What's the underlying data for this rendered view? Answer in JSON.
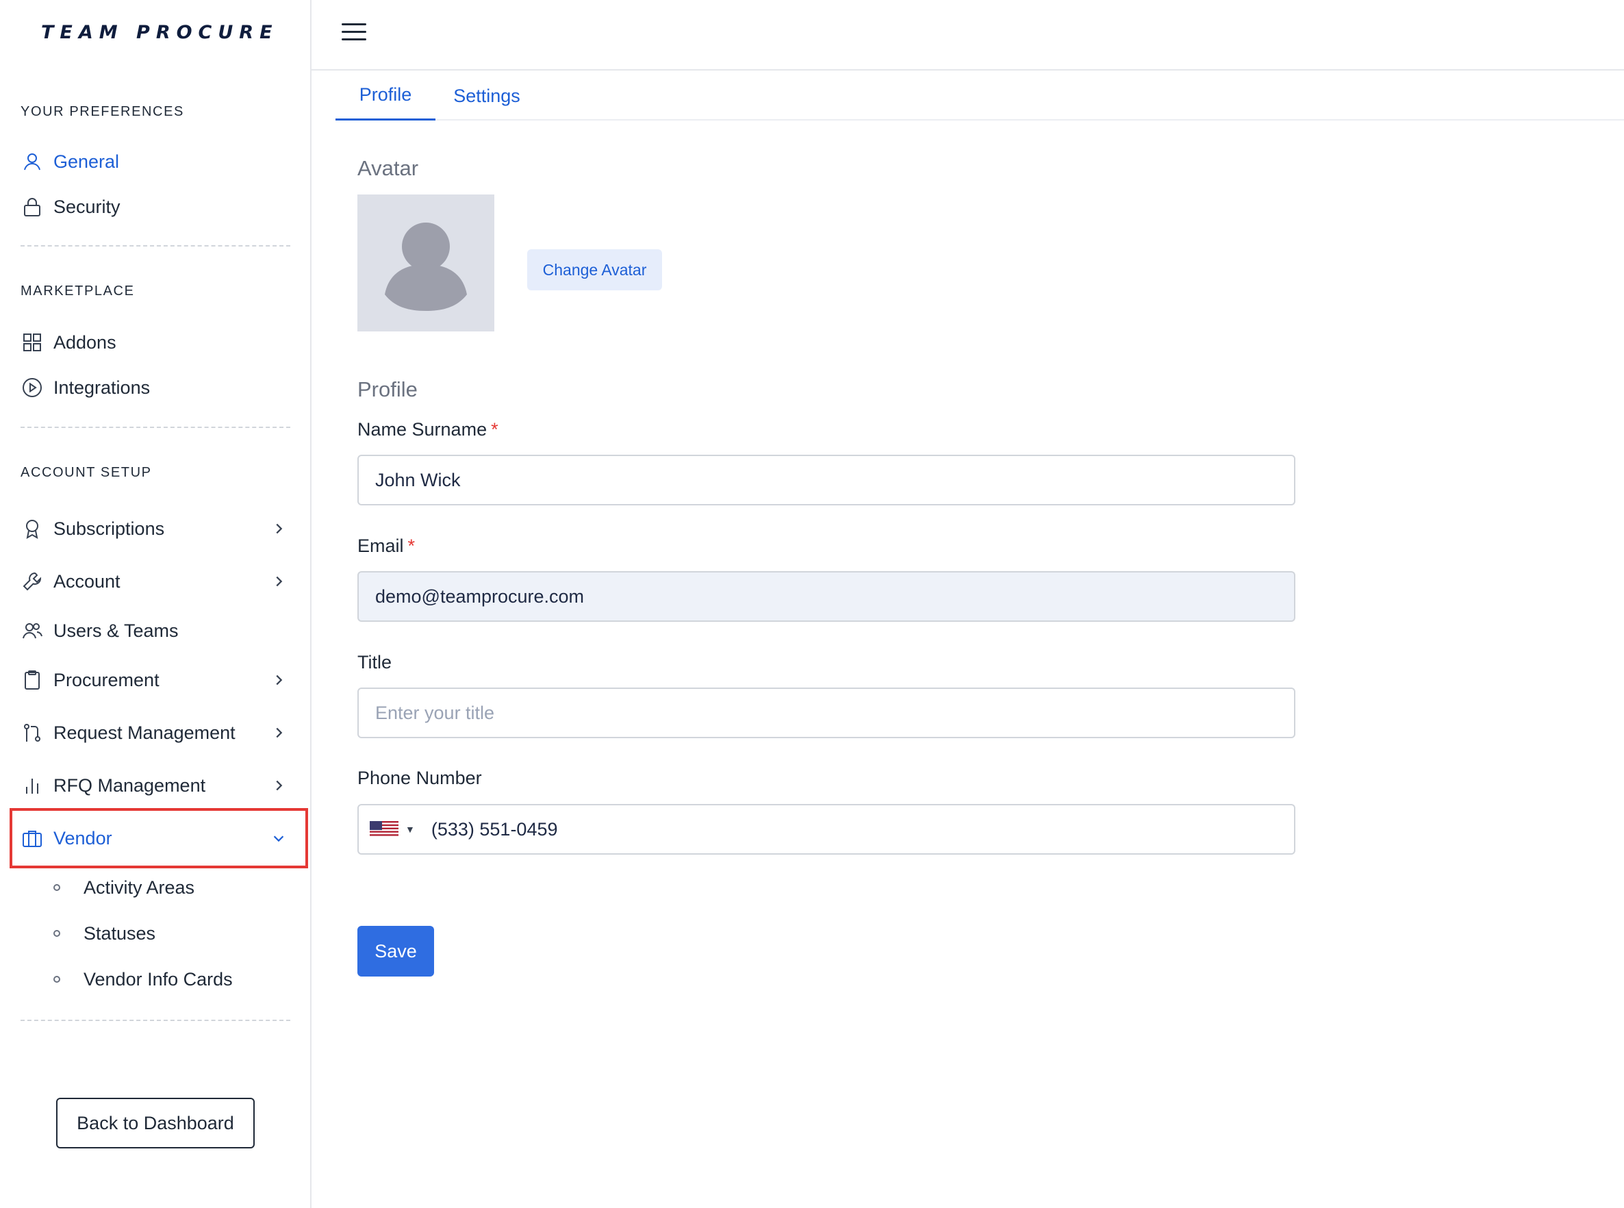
{
  "brand": {
    "logo_text": "TEAM PROCURE"
  },
  "sidebar": {
    "sections": {
      "preferences": "YOUR PREFERENCES",
      "marketplace": "MARKETPLACE",
      "account_setup": "ACCOUNT SETUP"
    },
    "items": {
      "general": "General",
      "security": "Security",
      "addons": "Addons",
      "integrations": "Integrations",
      "subscriptions": "Subscriptions",
      "account": "Account",
      "users_teams": "Users & Teams",
      "procurement": "Procurement",
      "request_management": "Request Management",
      "rfq_management": "RFQ Management",
      "vendor": "Vendor"
    },
    "vendor_subitems": {
      "activity_areas": "Activity Areas",
      "statuses": "Statuses",
      "vendor_info_cards": "Vendor Info Cards"
    },
    "back_button": "Back to Dashboard",
    "active_item": "General",
    "expanded_item": "Vendor"
  },
  "tabs": {
    "profile": "Profile",
    "settings": "Settings",
    "active": "Profile"
  },
  "avatar": {
    "heading": "Avatar",
    "change_button": "Change Avatar"
  },
  "profile_form": {
    "heading": "Profile",
    "name_label": "Name Surname",
    "name_value": "John Wick",
    "email_label": "Email",
    "email_value": "demo@teamprocure.com",
    "title_label": "Title",
    "title_placeholder": "Enter your title",
    "phone_label": "Phone Number",
    "phone_value": "(533) 551-0459",
    "phone_country": "us-flag-icon",
    "required_mark": "*",
    "save_button": "Save"
  },
  "colors": {
    "accent": "#1d5fd6",
    "primary_button": "#2f6de1",
    "required": "#e53935",
    "highlight_box": "#e53935",
    "disabled_input_bg": "#eef2f9"
  }
}
